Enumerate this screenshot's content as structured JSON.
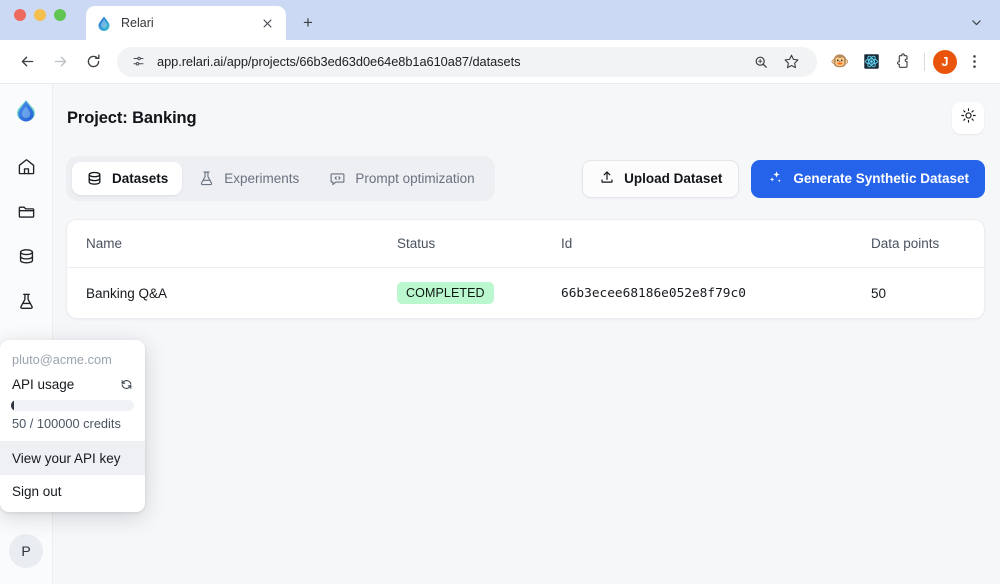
{
  "browser": {
    "tab": {
      "title": "Relari",
      "favicon_icon": "relari-droplet-icon",
      "close_icon": "close-icon"
    },
    "new_tab_label": "+",
    "nav": {
      "back_icon": "back-arrow-icon",
      "forward_icon": "forward-arrow-icon",
      "reload_icon": "reload-icon"
    },
    "omnibox": {
      "site_info_icon": "site-settings-icon",
      "url": "app.relari.ai/app/projects/66b3ed63d0e64e8b1a610a87/datasets",
      "zoom_icon": "zoom-search-icon",
      "bookmark_icon": "star-icon"
    },
    "toolbar_icons": [
      {
        "name": "extension-avatar-icon",
        "glyph": "🐵"
      },
      {
        "name": "react-devtools-icon",
        "glyph": "⚛"
      },
      {
        "name": "extensions-puzzle-icon",
        "glyph": "puzzle"
      }
    ],
    "profile": {
      "initial": "J",
      "color": "#e8540c"
    },
    "menu_icon": "kebab-menu-icon",
    "tabstrip_chevron_icon": "chevron-down-icon"
  },
  "rail": {
    "logo_icon": "relari-logo-icon",
    "items": [
      {
        "name": "home-icon",
        "label": "Home"
      },
      {
        "name": "folder-icon",
        "label": "Projects"
      },
      {
        "name": "database-icon",
        "label": "Datasets"
      },
      {
        "name": "flask-icon",
        "label": "Experiments"
      },
      {
        "name": "code-chat-icon",
        "label": "Prompt optimization"
      }
    ],
    "avatar_initial": "P"
  },
  "header": {
    "title": "Project: Banking",
    "theme_toggle_icon": "sun-icon"
  },
  "tabs": [
    {
      "label": "Datasets",
      "icon": "database-icon",
      "active": true
    },
    {
      "label": "Experiments",
      "icon": "flask-icon",
      "active": false
    },
    {
      "label": "Prompt optimization",
      "icon": "code-chat-icon",
      "active": false
    }
  ],
  "actions": {
    "upload": {
      "label": "Upload Dataset",
      "icon": "upload-icon"
    },
    "generate": {
      "label": "Generate Synthetic Dataset",
      "icon": "sparkles-icon",
      "color": "#2563eb"
    }
  },
  "table": {
    "columns": [
      "Name",
      "Status",
      "Id",
      "Data points"
    ],
    "rows": [
      {
        "name": "Banking Q&A",
        "status": "COMPLETED",
        "status_color": "#bbf7cf",
        "id": "66b3ecee68186e052e8f79c0",
        "data_points": "50"
      }
    ]
  },
  "account_menu": {
    "email": "pluto@acme.com",
    "usage_label": "API usage",
    "refresh_icon": "refresh-icon",
    "usage_percent": 0.05,
    "credits_text": "50 / 100000 credits",
    "items": [
      {
        "label": "View your API key",
        "hovered": true
      },
      {
        "label": "Sign out",
        "hovered": false
      }
    ]
  }
}
